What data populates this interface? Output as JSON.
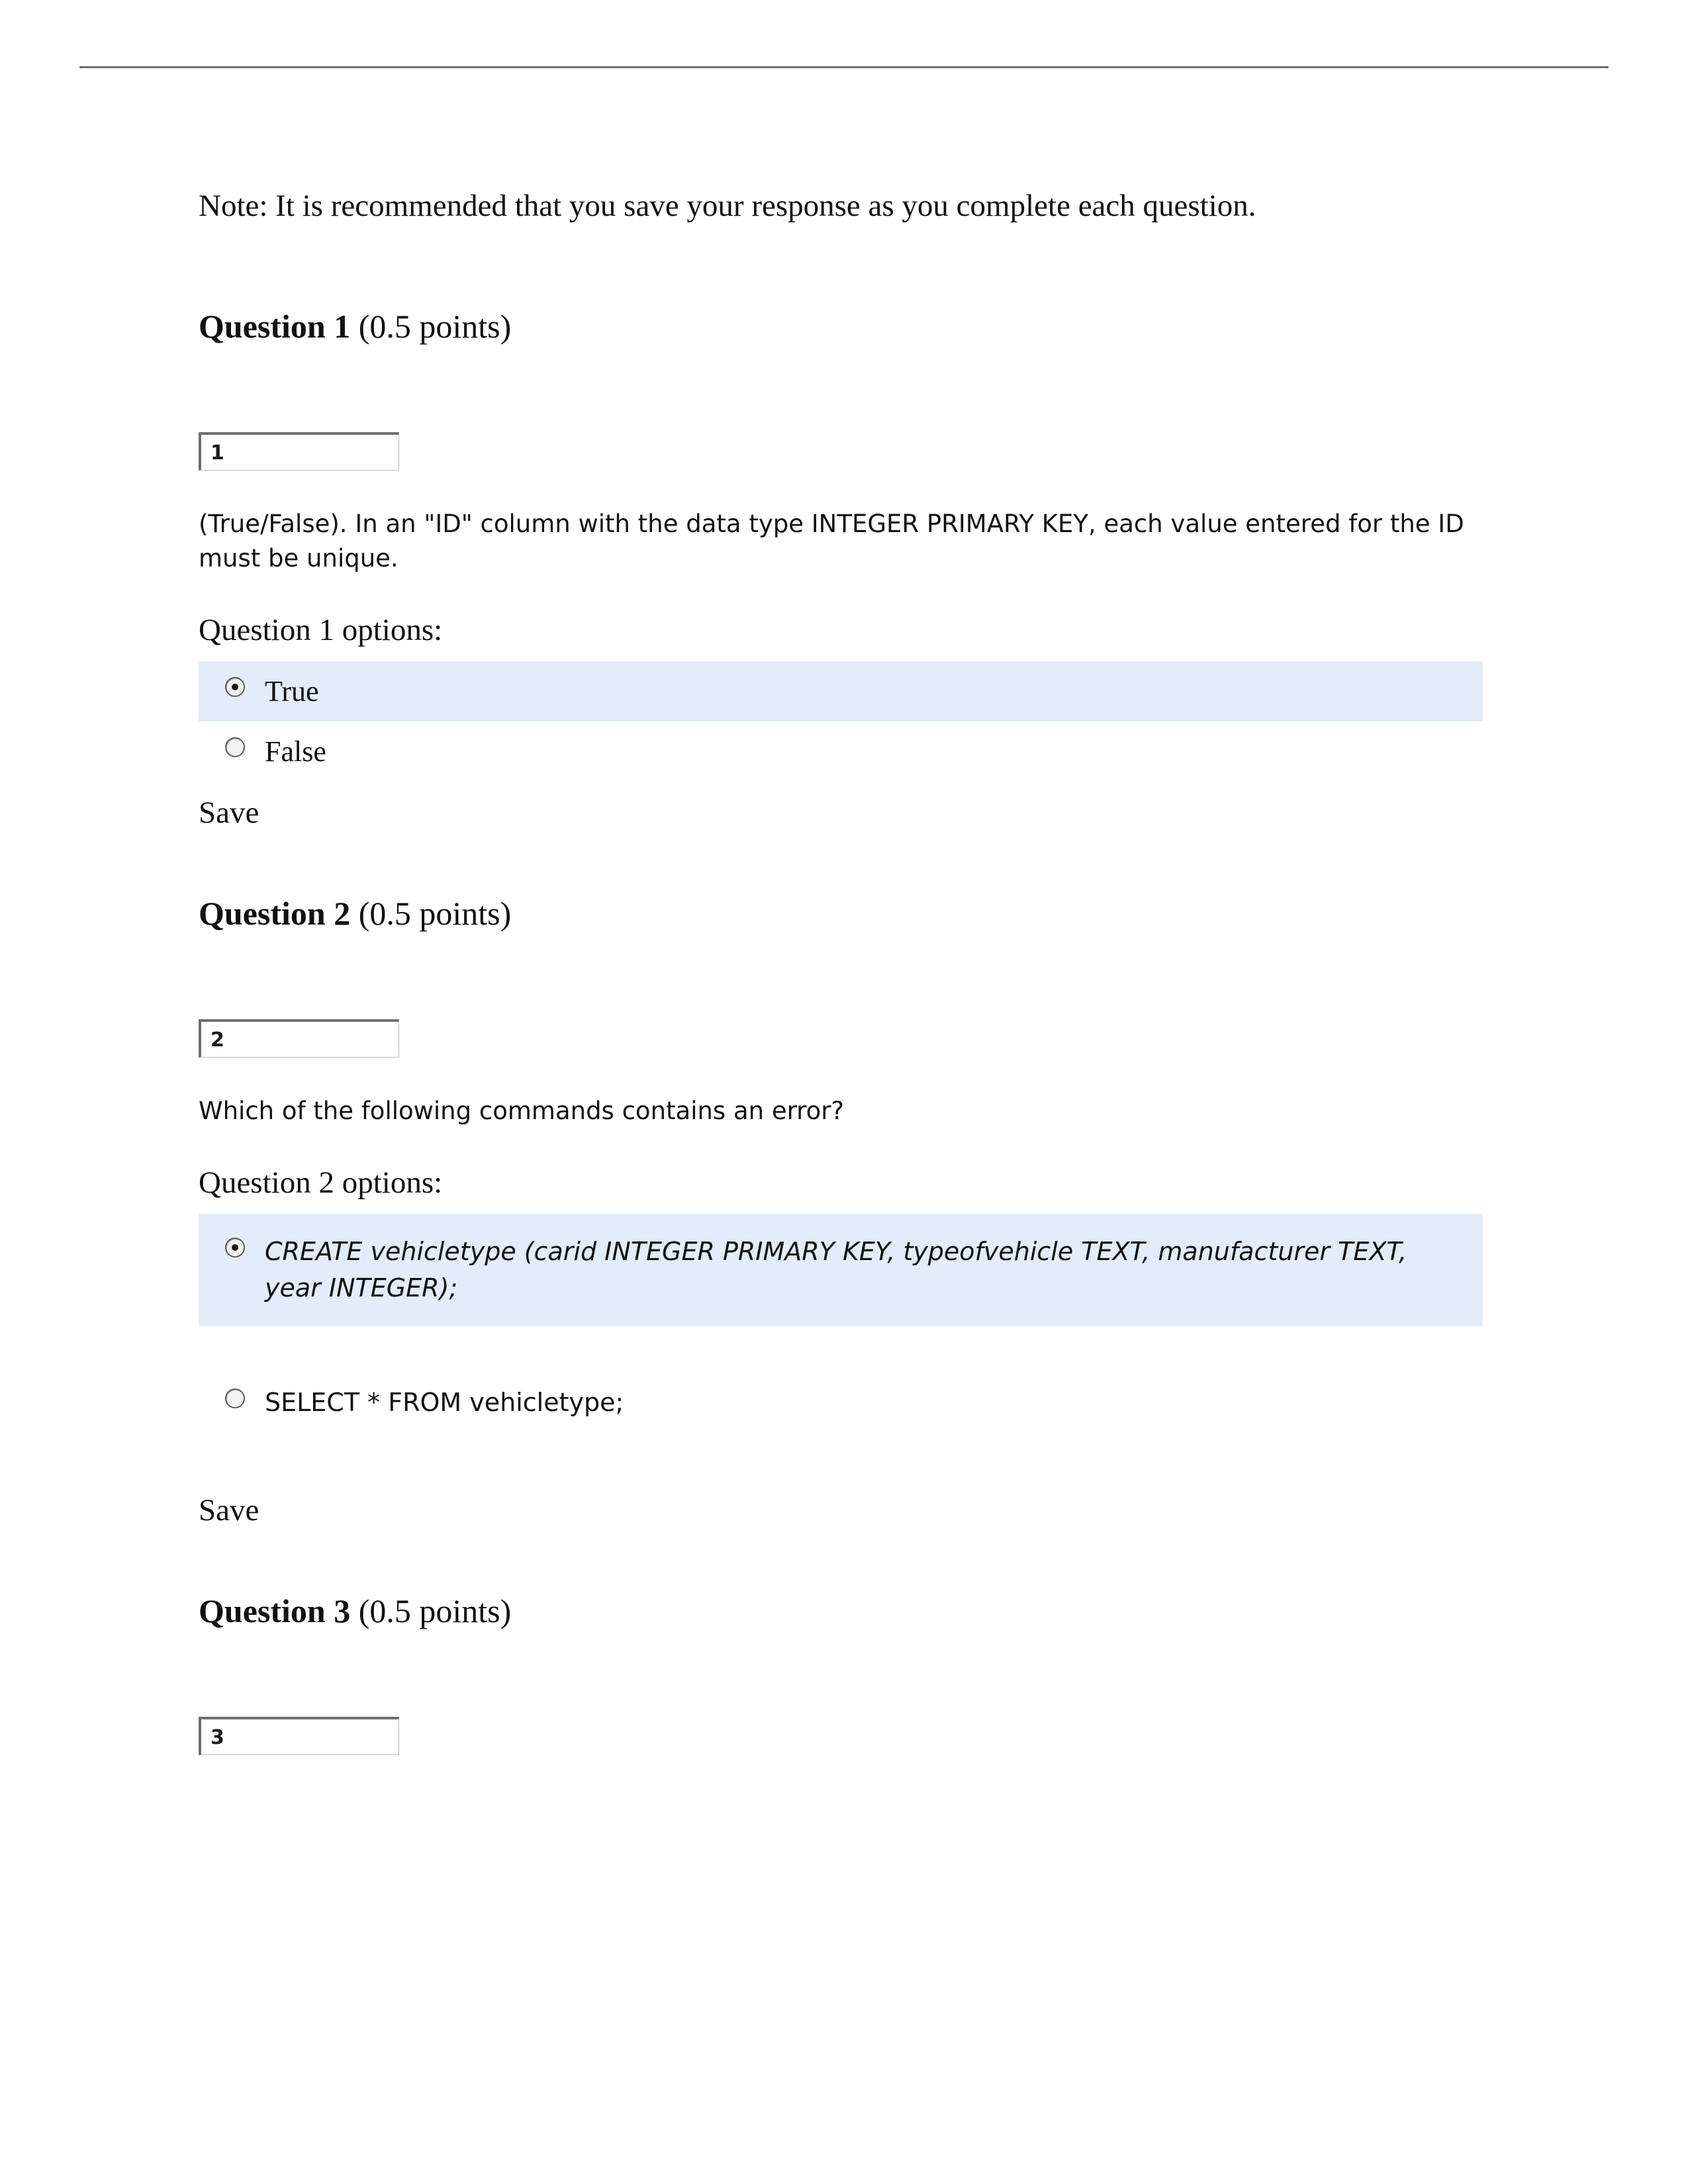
{
  "note": "Note: It is recommended that you save your response as you complete each question.",
  "questions": [
    {
      "label": "Question 1",
      "points": "(0.5 points)",
      "numBox": "1",
      "prompt": "(True/False). In an \"ID\" column with the data type INTEGER PRIMARY KEY, each value entered for the ID must be unique.",
      "optionsHeading": "Question 1 options:",
      "options": [
        {
          "text": "True",
          "selected": true
        },
        {
          "text": "False",
          "selected": false
        }
      ],
      "save": "Save"
    },
    {
      "label": "Question 2",
      "points": "(0.5 points)",
      "numBox": "2",
      "prompt": "Which of the following commands contains an error?",
      "optionsHeading": "Question 2 options:",
      "options": [
        {
          "text": "CREATE vehicletype (carid INTEGER PRIMARY KEY, typeofvehicle TEXT, manufacturer TEXT, year INTEGER);",
          "selected": true
        },
        {
          "text": "SELECT * FROM vehicletype;",
          "selected": false
        }
      ],
      "save": "Save"
    },
    {
      "label": "Question 3",
      "points": "(0.5 points)",
      "numBox": "3"
    }
  ]
}
